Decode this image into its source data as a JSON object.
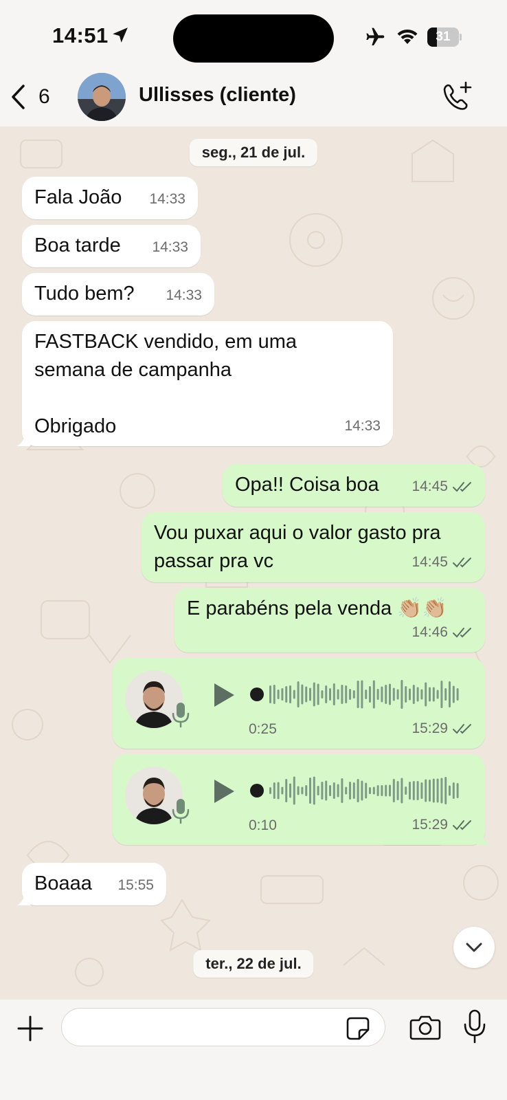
{
  "status_bar": {
    "time": "14:51",
    "battery": "31",
    "battery_level": 0.31
  },
  "header": {
    "back_count": "6",
    "contact_name": "Ullisses (cliente)"
  },
  "dates": {
    "first": "seg., 21 de jul.",
    "second": "ter., 22 de jul."
  },
  "messages": [
    {
      "direction": "in",
      "text": "Fala João",
      "time": "14:33"
    },
    {
      "direction": "in",
      "text": "Boa tarde",
      "time": "14:33"
    },
    {
      "direction": "in",
      "text": "Tudo bem?",
      "time": "14:33"
    },
    {
      "direction": "in",
      "text": "FASTBACK vendido, em uma\nsemana de campanha\n\nObrigado",
      "time": "14:33"
    },
    {
      "direction": "out",
      "text": "Opa!! Coisa boa",
      "time": "14:45",
      "status": "read"
    },
    {
      "direction": "out",
      "text": "Vou puxar aqui o valor gasto pra\npassar pra vc",
      "time": "14:45",
      "status": "read"
    },
    {
      "direction": "out",
      "text": "E parabéns pela venda 👏🏼👏🏼",
      "time": "14:46",
      "status": "read"
    },
    {
      "direction": "out",
      "type": "voice",
      "duration": "0:25",
      "time": "15:29",
      "status": "read"
    },
    {
      "direction": "out",
      "type": "voice",
      "duration": "0:10",
      "time": "15:29",
      "status": "read"
    },
    {
      "direction": "in",
      "text": "Boaaa",
      "time": "15:55"
    }
  ],
  "input": {
    "placeholder": "",
    "value": ""
  },
  "icons": {
    "back": "chevron-left-icon",
    "call": "add-call-icon",
    "plus": "plus-icon",
    "sticker": "sticker-icon",
    "camera": "camera-icon",
    "mic": "microphone-icon",
    "scroll": "chevron-down-icon",
    "play": "play-icon",
    "read": "double-check-icon"
  },
  "colors": {
    "outgoing_bubble": "#d7f9c9",
    "incoming_bubble": "#ffffff",
    "chat_background": "#efe7dd",
    "read_ticks": "#5a6f63",
    "waveform": "#7d9a86"
  }
}
